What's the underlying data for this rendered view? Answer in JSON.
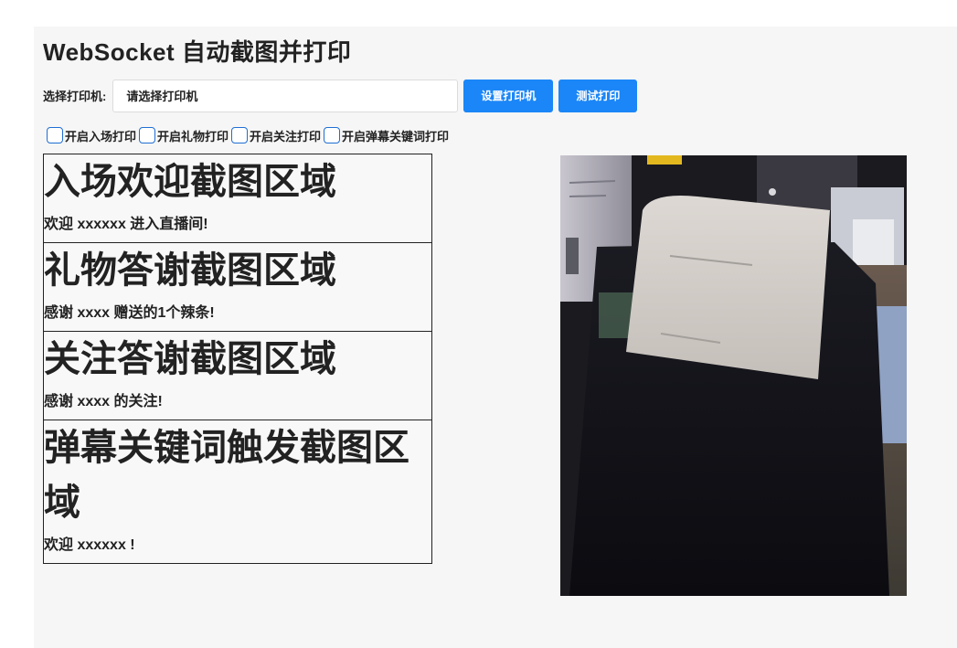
{
  "page": {
    "title": "WebSocket 自动截图并打印"
  },
  "printer": {
    "label": "选择打印机:",
    "select_value": "请选择打印机",
    "set_button": "设置打印机",
    "test_button": "测试打印"
  },
  "options": [
    {
      "label": "开启入场打印",
      "checked": false
    },
    {
      "label": "开启礼物打印",
      "checked": false
    },
    {
      "label": "开启关注打印",
      "checked": false
    },
    {
      "label": "开启弹幕关键词打印",
      "checked": false
    }
  ],
  "zones": [
    {
      "title": "入场欢迎截图区域",
      "text": "欢迎 xxxxxx 进入直播间!"
    },
    {
      "title": "礼物答谢截图区域",
      "text": "感谢 xxxx 赠送的1个辣条!"
    },
    {
      "title": "关注答谢截图区域",
      "text": "感谢 xxxx 的关注!"
    },
    {
      "title": "弹幕关键词触发截图区域",
      "text": "欢迎 xxxxxx !"
    }
  ],
  "colors": {
    "accent": "#1b86f7",
    "checkbox_border": "#1f6ed4",
    "background": "#f6f6f6"
  }
}
